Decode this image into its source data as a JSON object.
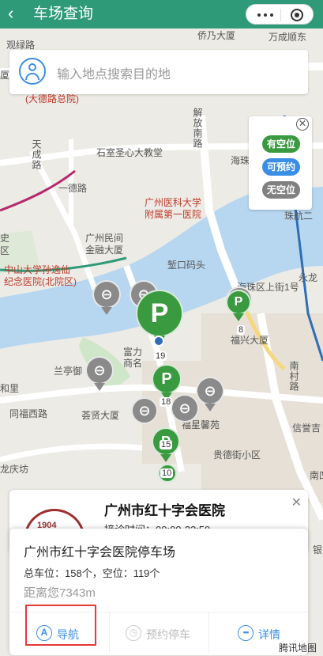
{
  "topbar": {
    "back_icon": "‹",
    "title": "车场查询"
  },
  "search": {
    "placeholder": "输入地点搜索目的地"
  },
  "legend": {
    "close": "✕",
    "items": [
      {
        "label": "有空位",
        "color": "#3a9a3f"
      },
      {
        "label": "可预约",
        "color": "#3a8ee6"
      },
      {
        "label": "无空位",
        "color": "#808080"
      }
    ]
  },
  "map_labels": {
    "l1": "观绿路",
    "l2": "侨乃大厦",
    "l3": "万成顺东",
    "l4": "厦",
    "l5": "(大德路总院)",
    "l6": "解放南路",
    "l7": "海珠",
    "l8": "天成路",
    "l9": "石室圣心大教堂",
    "l10": "一德路",
    "l11": "广州医科大学",
    "l12": "附属第一医院",
    "l13": "珠航二",
    "l14": "史",
    "l15": "区",
    "l16": "广州民间",
    "l17": "金融大厦",
    "l18": "堑口码头",
    "l19": "海珠区上街1号",
    "l20": "永龙",
    "l21": "中山大学孙逸仙",
    "l22": "纪念医院(北院区)",
    "l23": "福兴大厦",
    "l24": "富力",
    "l25": "商名",
    "l26": "兰亭御",
    "l27": "南村路",
    "l28": "和里",
    "l29": "同福西路",
    "l30": "荟贤大厦",
    "l31": "福星馨苑",
    "l32": "信誉吉",
    "l33": "贵德街小区",
    "l34": "龙庆坊",
    "l35": "南凹",
    "l36": "银"
  },
  "pins": {
    "big": "P",
    "p1": "P",
    "p2": "P",
    "p3": "P",
    "n1": "19",
    "n2": "18",
    "n3": "15",
    "n4": "10",
    "n5": "8"
  },
  "hospital_card": {
    "logo_text": "1904",
    "name": "广州市红十字会医院",
    "cutoff_text": "接诊时间：00:00-23:59",
    "close": "✕"
  },
  "parking_card": {
    "name": "广州市红十字会医院停车场",
    "counts": "总车位：158个，空位：119个",
    "distance": "距离您7343m",
    "actions": [
      {
        "label": "导航",
        "icon": "A"
      },
      {
        "label": "预约停车",
        "icon": "◷"
      },
      {
        "label": "详情",
        "icon": "•••"
      }
    ]
  },
  "attribution": "腾讯地图"
}
